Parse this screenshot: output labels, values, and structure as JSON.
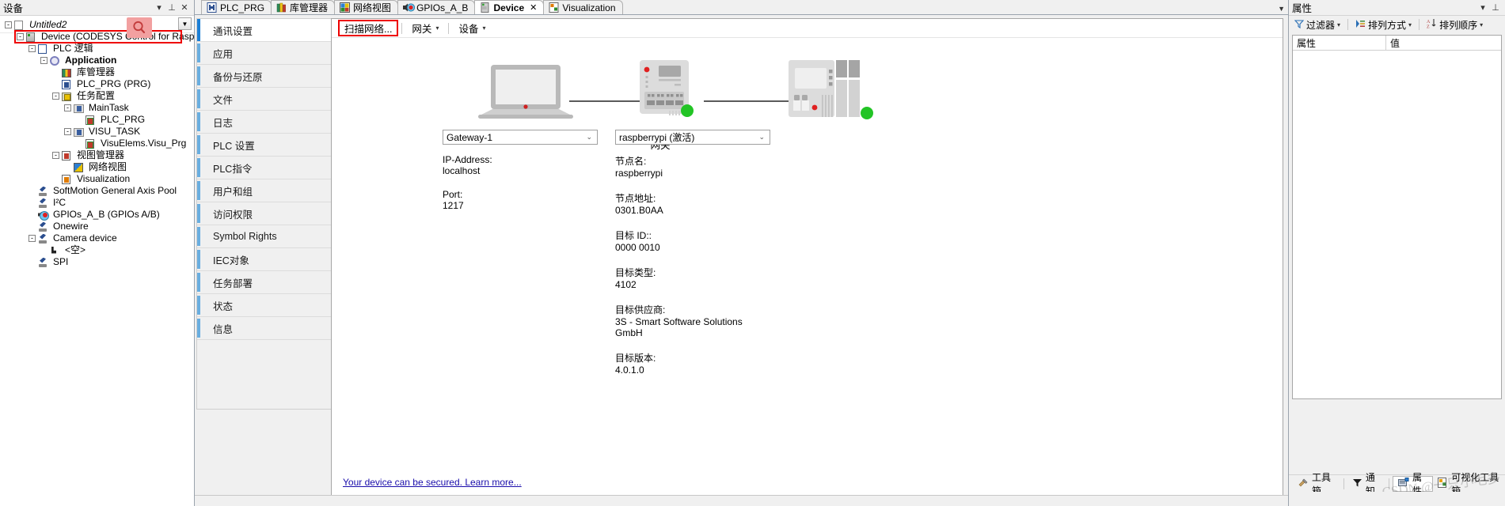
{
  "devices_panel": {
    "title": "设备",
    "toolbar_icons": [
      "dropdown-icon",
      "pin-icon",
      "close-icon"
    ],
    "search_icon": "search-icon",
    "tree": [
      {
        "indent": 0,
        "expander": "-",
        "icon": "project-icon",
        "label": "Untitled2",
        "style": "italic"
      },
      {
        "indent": 1,
        "expander": "-",
        "icon": "device-icon",
        "label": "Device (CODESYS Control for Raspberry Pi SL)",
        "selected": true
      },
      {
        "indent": 2,
        "expander": "-",
        "icon": "plc-logic-icon",
        "label": "PLC 逻辑"
      },
      {
        "indent": 3,
        "expander": "-",
        "icon": "application-icon",
        "label": "Application",
        "style": "bold"
      },
      {
        "indent": 4,
        "expander": "",
        "icon": "library-manager-icon",
        "label": "库管理器"
      },
      {
        "indent": 4,
        "expander": "",
        "icon": "program-icon",
        "label": "PLC_PRG (PRG)"
      },
      {
        "indent": 4,
        "expander": "-",
        "icon": "task-config-icon",
        "label": "任务配置"
      },
      {
        "indent": 5,
        "expander": "-",
        "icon": "task-icon",
        "label": "MainTask"
      },
      {
        "indent": 6,
        "expander": "",
        "icon": "pou-call-icon",
        "label": "PLC_PRG"
      },
      {
        "indent": 5,
        "expander": "-",
        "icon": "task-icon",
        "label": "VISU_TASK"
      },
      {
        "indent": 6,
        "expander": "",
        "icon": "pou-call-icon",
        "label": "VisuElems.Visu_Prg"
      },
      {
        "indent": 4,
        "expander": "-",
        "icon": "visu-manager-icon",
        "label": "视图管理器"
      },
      {
        "indent": 5,
        "expander": "",
        "icon": "web-visu-icon",
        "label": "网络视图"
      },
      {
        "indent": 4,
        "expander": "",
        "icon": "visualization-icon",
        "label": "Visualization"
      },
      {
        "indent": 2,
        "expander": "",
        "icon": "axis-pool-icon",
        "label": "SoftMotion General Axis Pool"
      },
      {
        "indent": 2,
        "expander": "",
        "icon": "axis-pool-icon",
        "label": "I²C"
      },
      {
        "indent": 2,
        "expander": "",
        "icon": "gpio-icon",
        "label": "GPIOs_A_B (GPIOs A/B)"
      },
      {
        "indent": 2,
        "expander": "",
        "icon": "axis-pool-icon",
        "label": "Onewire"
      },
      {
        "indent": 2,
        "expander": "-",
        "icon": "axis-pool-icon",
        "label": "Camera device"
      },
      {
        "indent": 3,
        "expander": "",
        "icon": "empty-slot-icon",
        "label": "<空>"
      },
      {
        "indent": 2,
        "expander": "",
        "icon": "axis-pool-icon",
        "label": "SPI"
      }
    ]
  },
  "editor": {
    "tabs": [
      {
        "label": "PLC_PRG",
        "icon": "program-icon",
        "active": false,
        "closable": false
      },
      {
        "label": "库管理器",
        "icon": "library-manager-icon",
        "active": false,
        "closable": false
      },
      {
        "label": "网络视图",
        "icon": "web-visu-icon",
        "active": false,
        "closable": false
      },
      {
        "label": "GPIOs_A_B",
        "icon": "gpio-icon",
        "active": false,
        "closable": false
      },
      {
        "label": "Device",
        "icon": "device-icon",
        "active": true,
        "closable": true,
        "close_label": "✕"
      },
      {
        "label": "Visualization",
        "icon": "visualization-icon",
        "active": false,
        "closable": false
      }
    ],
    "tabstrip_overflow_icon": "chevron-down-icon",
    "categories": [
      {
        "label": "通讯设置",
        "active": true
      },
      {
        "label": "应用",
        "active": false
      },
      {
        "label": "备份与还原",
        "active": false
      },
      {
        "label": "文件",
        "active": false
      },
      {
        "label": "日志",
        "active": false
      },
      {
        "label": "PLC 设置",
        "active": false
      },
      {
        "label": "PLC指令",
        "active": false
      },
      {
        "label": "用户和组",
        "active": false
      },
      {
        "label": "访问权限",
        "active": false
      },
      {
        "label": "Symbol Rights",
        "active": false
      },
      {
        "label": "IEC对象",
        "active": false
      },
      {
        "label": "任务部署",
        "active": false
      },
      {
        "label": "状态",
        "active": false
      },
      {
        "label": "信息",
        "active": false
      }
    ],
    "toolbar": {
      "scan_network": "扫描网络...",
      "gateway": "网关",
      "gateway_caret": "▾",
      "device": "设备",
      "device_caret": "▾"
    },
    "diagram": {
      "gateway_caption": "网关",
      "laptop_icon": "laptop-icon",
      "router_icon": "gateway-router-icon",
      "plc_icon": "plc-controller-icon",
      "gateway_status_color": "#22c425",
      "plc_status_color": "#22c425"
    },
    "gateway_column": {
      "combo_value": "Gateway-1",
      "combo_arrow": "chevron-down-icon",
      "fields": [
        {
          "key": "IP-Address:",
          "value": "localhost"
        },
        {
          "key": "Port:",
          "value": "1217"
        }
      ]
    },
    "device_column": {
      "combo_value": "raspberrypi (激活)",
      "combo_arrow": "chevron-down-icon",
      "fields": [
        {
          "key": "节点名:",
          "value": "raspberrypi"
        },
        {
          "key": "节点地址:",
          "value": "0301.B0AA"
        },
        {
          "key": "目标 ID::",
          "value": "0000 0010"
        },
        {
          "key": "目标类型:",
          "value": "4102"
        },
        {
          "key": "目标供应商:",
          "value": "3S - Smart Software Solutions GmbH"
        },
        {
          "key": "目标版本:",
          "value": "4.0.1.0"
        }
      ]
    },
    "secure_link": "Your device can be secured. Learn more..."
  },
  "properties_panel": {
    "title": "属性",
    "toolbar_icons": [
      "dropdown-icon",
      "pin-icon"
    ],
    "toolbar": [
      {
        "label": "过滤器",
        "icon": "filter-icon",
        "caret": "▾"
      },
      {
        "label": "排列方式",
        "icon": "sort-by-icon",
        "caret": "▾"
      },
      {
        "label": "排列顺序",
        "icon": "sort-order-icon",
        "caret": "▾"
      }
    ],
    "grid_headers": {
      "property": "属性",
      "value": "值"
    },
    "footer_buttons": [
      {
        "label": "工具箱",
        "icon": "toolbox-icon",
        "selected": false
      },
      {
        "label": "通知",
        "icon": "notify-icon",
        "selected": false
      },
      {
        "label": "属性",
        "icon": "properties-icon",
        "selected": true
      },
      {
        "label": "可视化工具箱",
        "icon": "visu-toolbox-icon",
        "selected": false
      }
    ],
    "watermark": "CSDN @一只小毛多"
  }
}
